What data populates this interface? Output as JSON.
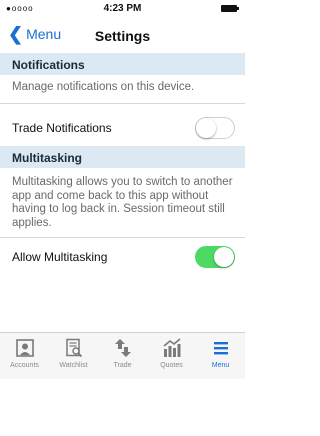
{
  "status_bar": {
    "time": "4:23 PM",
    "signal": "●oooo"
  },
  "nav": {
    "back_label": "Menu",
    "title": "Settings"
  },
  "notifications": {
    "header": "Notifications",
    "description": "Manage notifications on this device.",
    "trade_label": "Trade Notifications",
    "trade_enabled": false
  },
  "multitasking": {
    "header": "Multitasking",
    "description": "Multitasking allows you to switch to another app and come back to this app without having to log back in. Session timeout still applies.",
    "allow_label": "Allow Multitasking",
    "allow_enabled": true
  },
  "tabs": [
    {
      "label": "Accounts",
      "icon": "accounts-icon",
      "active": false
    },
    {
      "label": "Watchlist",
      "icon": "watchlist-icon",
      "active": false
    },
    {
      "label": "Trade",
      "icon": "trade-icon",
      "active": false
    },
    {
      "label": "Quotes",
      "icon": "quotes-icon",
      "active": false
    },
    {
      "label": "Menu",
      "icon": "menu-icon",
      "active": true
    }
  ],
  "colors": {
    "accent": "#1b6fd1",
    "toggle_on": "#4cd964",
    "section_bg": "#dce8f2"
  }
}
